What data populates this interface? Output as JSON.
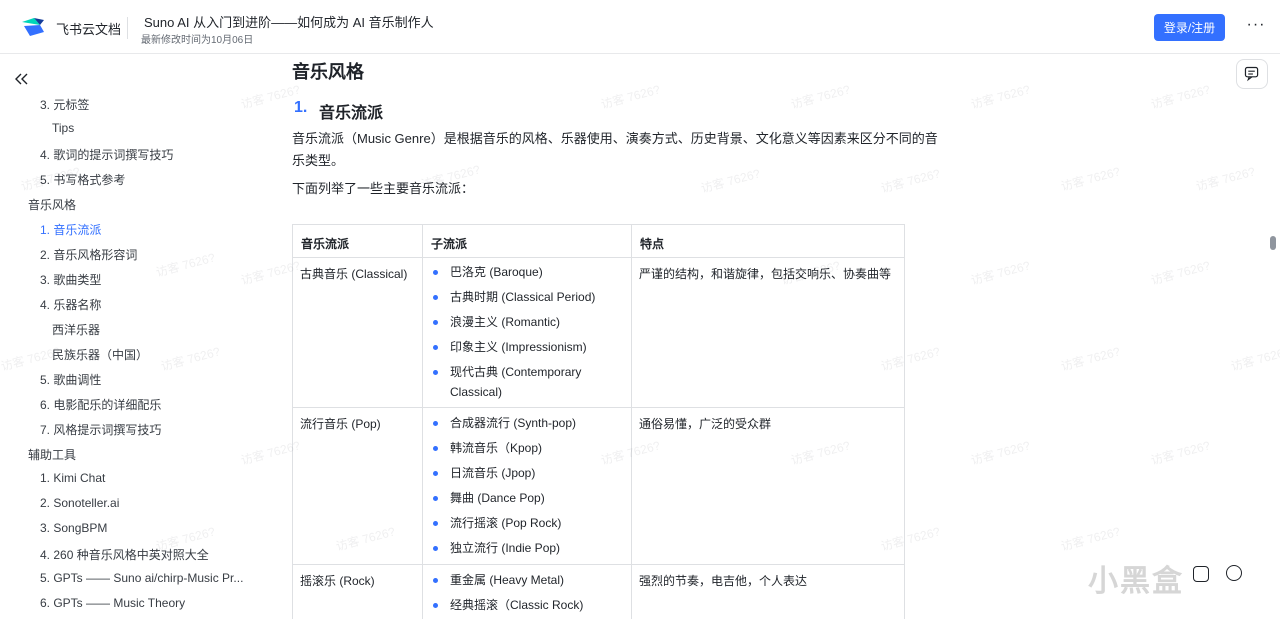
{
  "header": {
    "brand": "飞书云文档",
    "doc_title": "Suno AI 从入门到进阶——如何成为 AI 音乐制作人",
    "last_modified": "最新修改时间为10月06日",
    "login_label": "登录/注册",
    "more_label": "···"
  },
  "sidebar": {
    "collapse_label": "«",
    "items": [
      {
        "label": "3. 元标签",
        "active": false
      },
      {
        "label": "Tips",
        "active": false
      },
      {
        "label": "4. 歌词的提示词撰写技巧",
        "active": false
      },
      {
        "label": "5. 书写格式参考",
        "active": false
      },
      {
        "label": "音乐风格",
        "active": false
      },
      {
        "label": "1. 音乐流派",
        "active": true
      },
      {
        "label": "2. 音乐风格形容词",
        "active": false
      },
      {
        "label": "3. 歌曲类型",
        "active": false
      },
      {
        "label": "4. 乐器名称",
        "active": false
      },
      {
        "label": "西洋乐器",
        "active": false
      },
      {
        "label": "民族乐器（中国）",
        "active": false
      },
      {
        "label": "5. 歌曲调性",
        "active": false
      },
      {
        "label": "6. 电影配乐的详细配乐",
        "active": false
      },
      {
        "label": "7. 风格提示词撰写技巧",
        "active": false
      },
      {
        "label": "辅助工具",
        "active": false
      },
      {
        "label": "1. Kimi Chat",
        "active": false
      },
      {
        "label": "2. Sonoteller.ai",
        "active": false
      },
      {
        "label": "3. SongBPM",
        "active": false
      },
      {
        "label": "4. 260 种音乐风格中英对照大全",
        "active": false
      },
      {
        "label": "5. GPTs —— Suno ai/chirp-Music Pr...",
        "active": false
      },
      {
        "label": "6. GPTs —— Music Theory",
        "active": false
      }
    ]
  },
  "content": {
    "h1": "音乐风格",
    "h2_num": "1.",
    "h2": "音乐流派",
    "para1_line1": "音乐流派（Music Genre）是根据音乐的风格、乐器使用、演奏方式、历史背景、文化意义等因素来区分不同的音",
    "para1_line2": "乐类型。",
    "para2": "下面列举了一些主要音乐流派："
  },
  "table": {
    "headers": [
      "音乐流派",
      "子流派",
      "特点"
    ],
    "rows": [
      {
        "genre": "古典音乐 (Classical)",
        "subgenres": [
          "巴洛克 (Baroque)",
          "古典时期 (Classical Period)",
          "浪漫主义 (Romantic)",
          "印象主义 (Impressionism)",
          "现代古典 (Contemporary",
          "Classical)"
        ],
        "features": "严谨的结构，和谐旋律，包括交响乐、协奏曲等"
      },
      {
        "genre": "流行音乐 (Pop)",
        "subgenres": [
          "合成器流行 (Synth-pop)",
          "韩流音乐（Kpop)",
          "日流音乐 (Jpop)",
          "舞曲 (Dance Pop)",
          "流行摇滚 (Pop Rock)",
          "独立流行 (Indie Pop)"
        ],
        "features": "通俗易懂，广泛的受众群"
      },
      {
        "genre": "摇滚乐 (Rock)",
        "subgenres": [
          "重金属 (Heavy Metal)",
          "经典摇滚（Classic Rock)"
        ],
        "features": "强烈的节奏，电吉他，个人表达"
      }
    ]
  },
  "watermark": "访客 7626?",
  "site_mark": "小黑盒",
  "icons": {
    "logo": "feishu-logo-icon",
    "comment": "comment-icon",
    "collapse": "double-chevron-left-icon"
  },
  "colors": {
    "accent": "#3370ff",
    "text": "#1f2329",
    "border": "#dee0e3"
  }
}
